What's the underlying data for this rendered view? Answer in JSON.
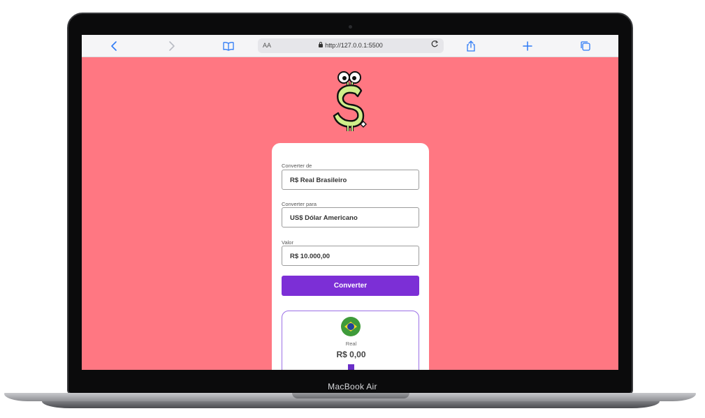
{
  "device": {
    "label": "MacBook Air"
  },
  "browser": {
    "back_icon": "chevron-left-icon",
    "forward_icon": "chevron-right-icon",
    "reader_icon": "book-icon",
    "text_size": "AA",
    "url": "http://127.0.0.1:5500",
    "share_icon": "share-icon",
    "new_tab_icon": "plus-icon",
    "tabs_icon": "tabs-icon"
  },
  "converter": {
    "from_label": "Converter de",
    "from_value": "R$ Real Brasileiro",
    "to_label": "Converter para",
    "to_value": "US$ Dólar Americano",
    "amount_label": "Valor",
    "amount_value": "R$ 10.000,00",
    "convert_button": "Converter"
  },
  "result": {
    "flag_icon": "brazil-flag-icon",
    "currency_name": "Real",
    "currency_value": "R$ 0,00"
  },
  "colors": {
    "page_background": "#ff7782",
    "button": "#7c2fd6",
    "result_border": "#9b70e6",
    "browser_accent": "#2f7bf6"
  }
}
